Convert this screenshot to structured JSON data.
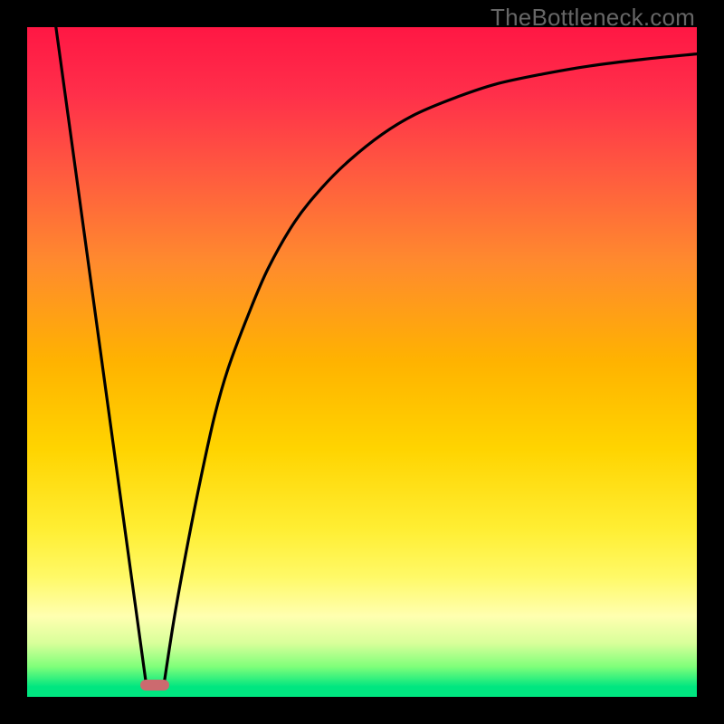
{
  "watermark": "TheBottleneck.com",
  "chart_data": {
    "type": "line",
    "title": "",
    "xlabel": "",
    "ylabel": "",
    "x_range": [
      0,
      1
    ],
    "y_range": [
      0,
      1
    ],
    "grid": false,
    "legend": false,
    "background_gradient_stops": [
      {
        "offset": 0.0,
        "color": "#ff1744"
      },
      {
        "offset": 0.1,
        "color": "#ff2f4a"
      },
      {
        "offset": 0.22,
        "color": "#ff5b3f"
      },
      {
        "offset": 0.35,
        "color": "#ff8a2e"
      },
      {
        "offset": 0.5,
        "color": "#ffb300"
      },
      {
        "offset": 0.63,
        "color": "#ffd400"
      },
      {
        "offset": 0.75,
        "color": "#ffee33"
      },
      {
        "offset": 0.82,
        "color": "#fff966"
      },
      {
        "offset": 0.88,
        "color": "#ffffb0"
      },
      {
        "offset": 0.92,
        "color": "#d8ff9a"
      },
      {
        "offset": 0.955,
        "color": "#7fff7a"
      },
      {
        "offset": 0.985,
        "color": "#00e680"
      },
      {
        "offset": 1.0,
        "color": "#00e680"
      }
    ],
    "series": [
      {
        "name": "left-line",
        "x": [
          0.043,
          0.178
        ],
        "y": [
          1.0,
          0.017
        ]
      },
      {
        "name": "right-curve",
        "x": [
          0.204,
          0.22,
          0.24,
          0.26,
          0.28,
          0.3,
          0.33,
          0.36,
          0.4,
          0.44,
          0.48,
          0.53,
          0.58,
          0.64,
          0.7,
          0.77,
          0.84,
          0.92,
          1.0
        ],
        "y": [
          0.017,
          0.12,
          0.23,
          0.33,
          0.42,
          0.49,
          0.57,
          0.64,
          0.71,
          0.76,
          0.8,
          0.84,
          0.87,
          0.895,
          0.915,
          0.93,
          0.942,
          0.952,
          0.96
        ]
      }
    ],
    "marker": {
      "x_center": 0.191,
      "y": 0.017,
      "width_frac": 0.043,
      "color": "#cc6a6f"
    }
  }
}
